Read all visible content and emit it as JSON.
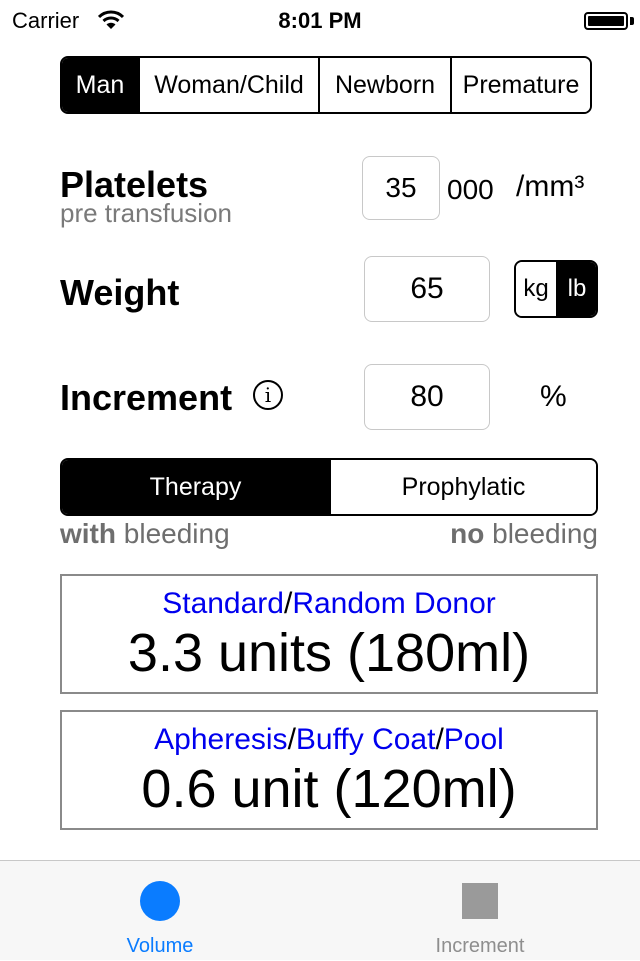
{
  "status_bar": {
    "carrier": "Carrier",
    "time": "8:01 PM"
  },
  "patient_type": {
    "options": [
      "Man",
      "Woman/Child",
      "Newborn",
      "Premature"
    ],
    "selected": "Man"
  },
  "platelets": {
    "label": "Platelets",
    "sublabel": "pre transfusion",
    "value": "35",
    "suffix": "000",
    "unit": "/mm³"
  },
  "weight": {
    "label": "Weight",
    "value": "65",
    "units": [
      "kg",
      "lb"
    ],
    "selected_unit": "lb"
  },
  "increment": {
    "label": "Increment",
    "value": "80",
    "unit": "%"
  },
  "mode": {
    "options": [
      "Therapy",
      "Prophylatic"
    ],
    "selected": "Therapy",
    "hint_left_bold": "with",
    "hint_left_rest": " bleeding",
    "hint_right_bold": "no",
    "hint_right_rest": " bleeding"
  },
  "results": {
    "standard": {
      "link1": "Standard",
      "sep": "/",
      "link2": "Random Donor",
      "value": "3.3 units (180ml)"
    },
    "apheresis": {
      "link1": "Apheresis",
      "sep1": "/",
      "link2": "Buffy Coat",
      "sep2": "/",
      "link3": "Pool",
      "value": "0.6 unit (120ml)"
    }
  },
  "tabbar": {
    "tabs": [
      {
        "label": "Volume",
        "icon": "circle-icon",
        "active": true
      },
      {
        "label": "Increment",
        "icon": "square-icon",
        "active": false
      }
    ],
    "colors": {
      "active": "#0a7cff",
      "inactive": "#8e8e8e"
    }
  }
}
